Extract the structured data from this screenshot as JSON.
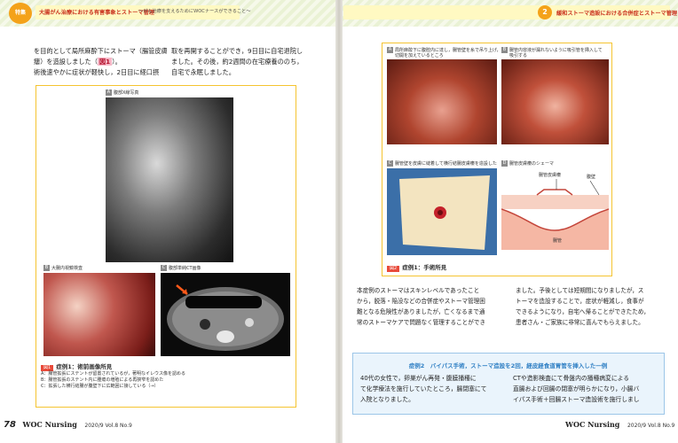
{
  "header": {
    "tokushu_badge": "特集",
    "left_title": "大腸がん治療における有害事象とストーマ管理",
    "left_subtitle": "〜がん治療を支えるためにWOCナースができること〜",
    "chapter_number": "2",
    "right_title": "緩和ストーマ造設における合併症とストーマ管理"
  },
  "left_page": {
    "body_lines": [
      "を目的として局所麻酔下にストーマ（腸管皮膚",
      "瘻）を造設しました（",
      "術後速やかに症状が軽快し，2日目に経口摂"
    ],
    "figure_ref": "図1",
    "body_line2_tail": "）。",
    "body_right_lines": [
      "取を再開することができ，9日目に自宅退院し",
      "ました。その後，約2週間の在宅療養ののち，",
      "自宅で永眠しました。"
    ],
    "figure": {
      "panel_a": {
        "letter": "A",
        "label": "腹部X線写真"
      },
      "panel_b": {
        "letter": "B",
        "label": "大腸内視鏡検査"
      },
      "panel_c": {
        "letter": "C",
        "label": "腹部単純CT画像"
      },
      "caption_tag": "図1",
      "caption_title": "症例1：術前画像所見",
      "caption_lines": [
        "A：腸管拡張にステントが留置されているが，著明なイレウス像を認める",
        "B：腸管拡張のステント内に腫瘍の増殖による再狭窄を認めた",
        "C：拡張した横行結腸が腹壁下に広範囲に接している（→）"
      ]
    },
    "footer": {
      "page_number": "78",
      "brand": "WOC Nursing",
      "issue": "2020/9 Vol.8 No.9"
    }
  },
  "right_page": {
    "figure": {
      "panel_a": {
        "letter": "A",
        "label_lines": [
          "局所麻酔下に腹腔内に達し，腸管壁を糸で吊り上げ，",
          "切開を加えているところ"
        ]
      },
      "panel_b": {
        "letter": "B",
        "label_lines": [
          "腸管内容液が漏れないように吸引管を挿入して",
          "吸引する"
        ]
      },
      "panel_c": {
        "letter": "C",
        "label": "腸管壁を皮膚に縫着して横行結腸皮膚瘻を造設した"
      },
      "panel_d": {
        "letter": "D",
        "label": "腸管皮膚瘻のシェーマ"
      },
      "schema_labels": {
        "fistula": "腸管皮膚瘻",
        "wall": "腹壁",
        "bowel": "腸管"
      },
      "caption_tag": "図2",
      "caption_title": "症例1：手術所見"
    },
    "body_left_lines": [
      "本症例のストーマはスキンレベルであったこと",
      "から，脱落・陥没などの合併症やストーマ管理困",
      "難となる危険性がありましたが，亡くなるまで通",
      "常のストーマケアで問題なく管理することができ"
    ],
    "body_right_lines": [
      "ました。予後としては短期間になりましたが，ス",
      "トーマを造設することで，症状が軽減し，食事が",
      "できるようになり，自宅へ帰ることができたため，",
      "患者さん・ご家族に非常に喜んでもらえました。"
    ],
    "case_box": {
      "heading": "症例2　バイパス手術，ストーマ造設を2回，経皮経食道胃管を挿入した一例",
      "left_lines": [
        "40代の女性で，卵巣がん再発・腹膜播種に",
        "て化学療法を施行していたところ，腸閉塞にて",
        "入院となりました。"
      ],
      "right_lines": [
        "CTや造影検査にて骨盤内の播種病変による",
        "直腸および回腸の閉塞が明らかになり，小腸バ",
        "イパス手術＋回腸ストーマ造設術を施行しまし"
      ]
    },
    "footer": {
      "brand": "WOC Nursing",
      "issue": "2020/9 Vol.8 No.9",
      "page_number": "79"
    }
  }
}
